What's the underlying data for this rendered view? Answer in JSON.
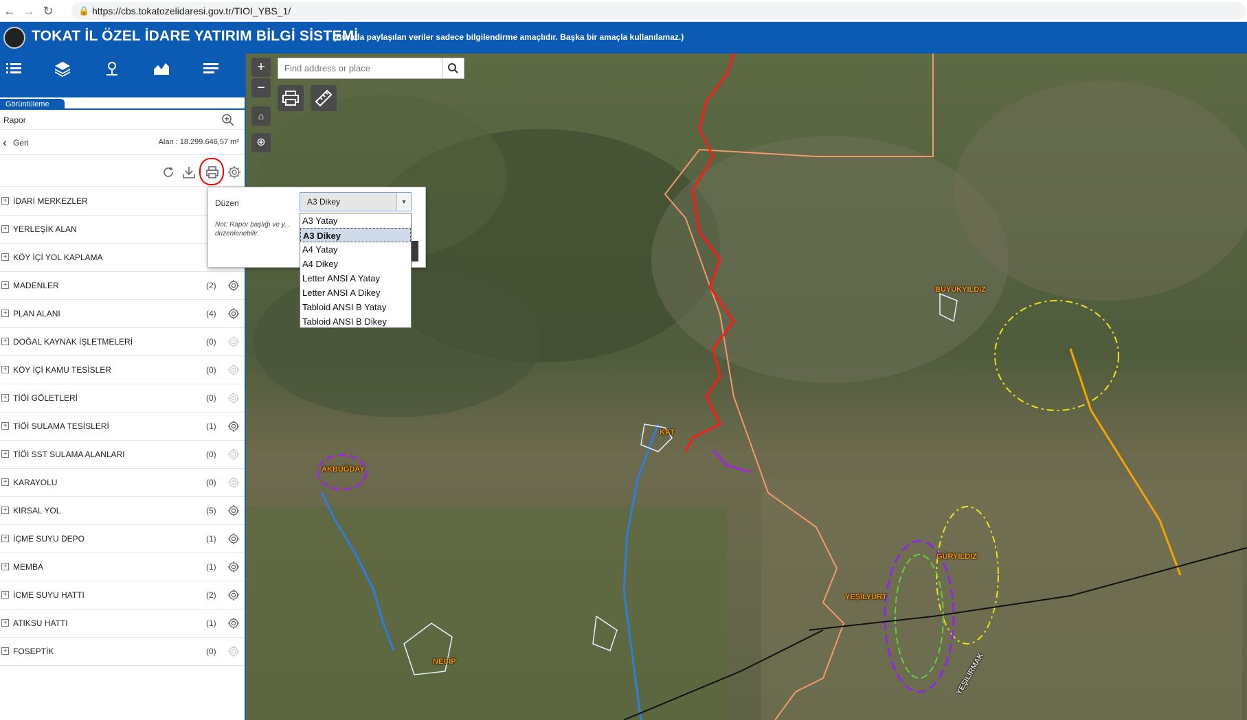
{
  "browser": {
    "url": "https://cbs.tokatozelidaresi.gov.tr/TIOI_YBS_1/"
  },
  "header": {
    "title": "TOKAT İL ÖZEL İDARE YATIRIM BİLGİ SİSTEMİ",
    "note": "(Burada paylaşılan veriler sadece bilgilendirme amaçlıdır. Başka bir amaçla kullanılamaz.)"
  },
  "sidebar": {
    "tab_label": "Görüntüleme",
    "search_text": "Rapor",
    "back_label": "Geri",
    "area_text": "Alan : 18.299.646,57 m²",
    "layers": [
      {
        "name": "İDARİ MERKEZLER",
        "count": ""
      },
      {
        "name": "YERLEŞİK ALAN",
        "count": ""
      },
      {
        "name": "KÖY İÇİ YOL KAPLAMA",
        "count": ""
      },
      {
        "name": "MADENLER",
        "count": "(2)"
      },
      {
        "name": "PLAN ALANI",
        "count": "(4)"
      },
      {
        "name": "DOĞAL KAYNAK İŞLETMELERİ",
        "count": "(0)"
      },
      {
        "name": "KÖY İÇİ KAMU TESİSLER",
        "count": "(0)"
      },
      {
        "name": "TİÖİ GÖLETLERİ",
        "count": "(0)"
      },
      {
        "name": "TİÖİ SULAMA TESİSLERİ",
        "count": "(1)"
      },
      {
        "name": "TİÖİ SST SULAMA ALANLARI",
        "count": "(0)"
      },
      {
        "name": "KARAYOLU",
        "count": "(0)"
      },
      {
        "name": "KIRSAL YOL",
        "count": "(5)"
      },
      {
        "name": "İÇME SUYU DEPO",
        "count": "(1)"
      },
      {
        "name": "MEMBA",
        "count": "(1)"
      },
      {
        "name": "İCME SUYU HATTI",
        "count": "(2)"
      },
      {
        "name": "ATIKSU HATTI",
        "count": "(1)"
      },
      {
        "name": "FOSEPTİK",
        "count": "(0)"
      }
    ]
  },
  "map": {
    "search_placeholder": "Find address or place",
    "places": [
      "AKBUĞDAY",
      "NECİP",
      "BÜYÜKYILDIZ",
      "GÜRYILDIZ",
      "YEŞİLYURT",
      "YEŞİLIRMAK",
      "KAT"
    ]
  },
  "print_popup": {
    "layout_label": "Düzen",
    "selected": "A3 Dikey",
    "note": "Not: Rapor başlığı ve y... düzenlenebilir.",
    "options": [
      "A3 Yatay",
      "A3 Dikey",
      "A4 Yatay",
      "A4 Dikey",
      "Letter ANSI A Yatay",
      "Letter ANSI A Dikey",
      "Tabloid ANSI B Yatay",
      "Tabloid ANSI B Dikey"
    ]
  },
  "colors": {
    "brand": "#0b5bb5",
    "highlight": "#ff0000"
  }
}
